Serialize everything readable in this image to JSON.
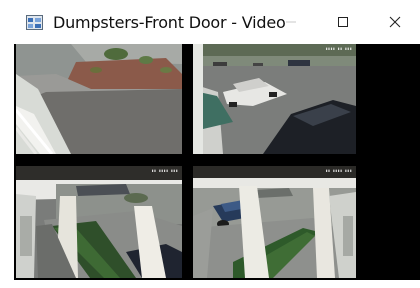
{
  "window": {
    "title": "Dumpsters-Front Door - Video",
    "app_icon": "video-window-icon",
    "controls": [
      "minimize-icon",
      "maximize-icon",
      "close-icon"
    ]
  },
  "feeds": [
    {
      "name": "camera-feed-1",
      "scene": "walkway and landscaped planter"
    },
    {
      "name": "camera-feed-2",
      "scene": "parking lot with parked vehicles"
    },
    {
      "name": "camera-feed-3",
      "scene": "covered porch looking at parking lot"
    },
    {
      "name": "camera-feed-4",
      "scene": "covered porch with hedge and parked car"
    }
  ],
  "colors": {
    "titlebar": "#ffffff",
    "video_background": "#000000"
  }
}
